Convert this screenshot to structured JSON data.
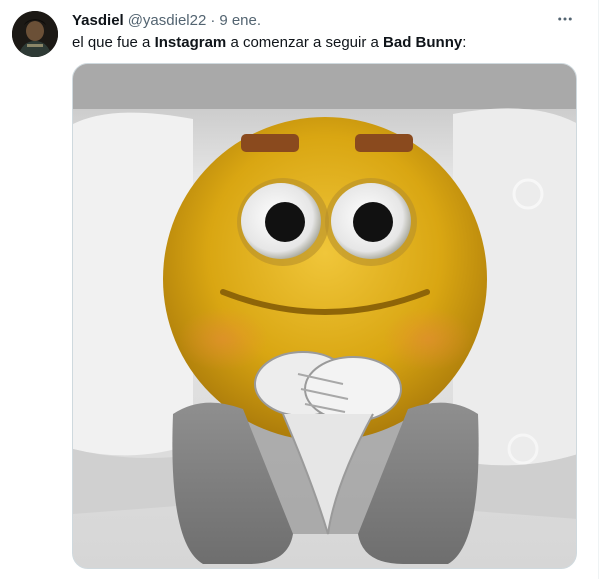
{
  "tweet": {
    "display_name": "Yasdiel",
    "handle": "@yasdiel22",
    "separator": "·",
    "time": "9 ene.",
    "text_parts": {
      "p1": "el que fue a ",
      "b1": "Instagram",
      "p2": " a comenzar a seguir a ",
      "b2": "Bad Bunny",
      "p3": ":"
    },
    "more_icon": "more-horizontal-icon",
    "media_alt": "Imagen"
  },
  "colors": {
    "text": "#0f1419",
    "secondary": "#536471",
    "border": "#cfd9de"
  }
}
